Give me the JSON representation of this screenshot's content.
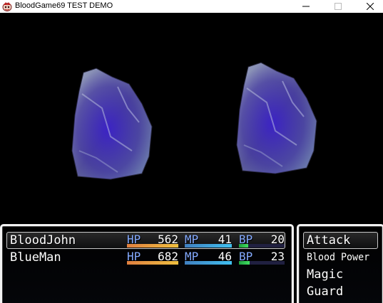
{
  "window": {
    "title": "BloodGame69 TEST DEMO",
    "icon": "game-app-icon",
    "controls": [
      "minimize-icon",
      "maximize-icon",
      "close-icon"
    ]
  },
  "enemies": [
    {
      "sprite": "rock-monster-sprite"
    },
    {
      "sprite": "rock-monster-sprite"
    }
  ],
  "party": {
    "labels": {
      "hp": "HP",
      "mp": "MP",
      "bp": "BP"
    },
    "actors": [
      {
        "name": "BloodJohn",
        "hp": "562",
        "mp": "41",
        "bp": "20",
        "hp_rate": 1.0,
        "mp_rate": 1.0,
        "bp_rate": 0.2
      },
      {
        "name": "BlueMan",
        "hp": "682",
        "mp": "46",
        "bp": "23",
        "hp_rate": 1.0,
        "mp_rate": 1.0,
        "bp_rate": 0.23
      }
    ],
    "selected_index": 0
  },
  "commands": {
    "items": [
      "Attack",
      "Blood Power",
      "Magic",
      "Guard"
    ],
    "selected_index": 0,
    "more_indicator": "scroll-down-arrow"
  },
  "colors": {
    "system_label": "#84aaff",
    "hp_gauge": "#f0a040",
    "mp_gauge": "#40a0e0",
    "bp_gauge": "#30c050"
  }
}
